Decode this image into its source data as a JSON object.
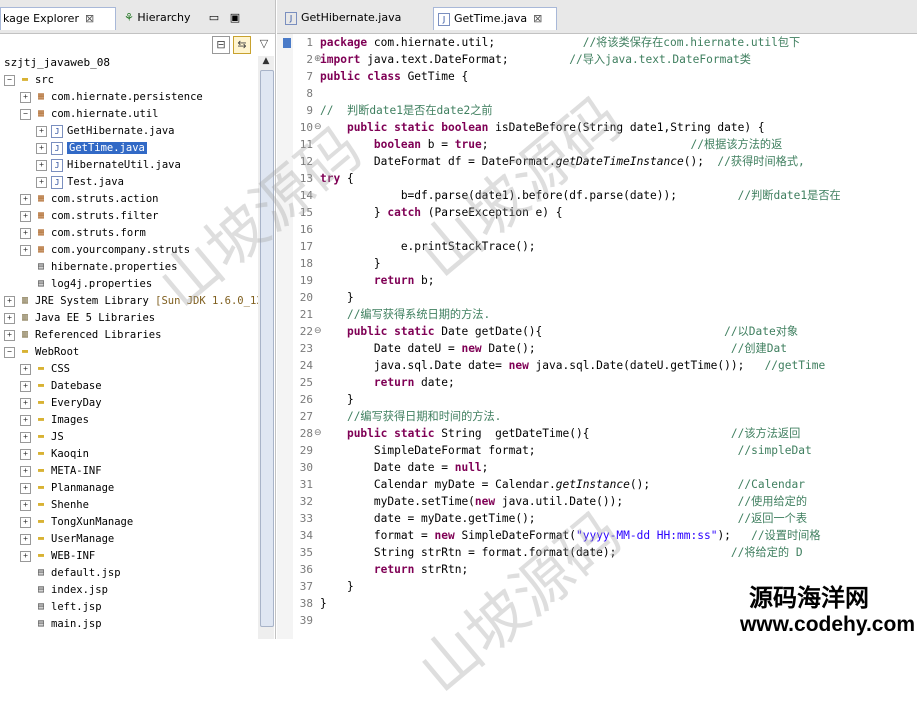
{
  "explorer": {
    "tab_label": "kage Explorer",
    "hierarchy_label": "Hierarchy",
    "project": "szjtj_javaweb_08",
    "tree": [
      {
        "depth": 0,
        "exp": "−",
        "icon": "folder",
        "label": "src"
      },
      {
        "depth": 1,
        "exp": "+",
        "icon": "pkg",
        "label": "com.hiernate.persistence"
      },
      {
        "depth": 1,
        "exp": "−",
        "icon": "pkg",
        "label": "com.hiernate.util"
      },
      {
        "depth": 2,
        "exp": "+",
        "icon": "java",
        "label": "GetHibernate.java"
      },
      {
        "depth": 2,
        "exp": "+",
        "icon": "java",
        "label": "GetTime.java",
        "selected": true
      },
      {
        "depth": 2,
        "exp": "+",
        "icon": "java",
        "label": "HibernateUtil.java"
      },
      {
        "depth": 2,
        "exp": "+",
        "icon": "java",
        "label": "Test.java"
      },
      {
        "depth": 1,
        "exp": "+",
        "icon": "pkg",
        "label": "com.struts.action"
      },
      {
        "depth": 1,
        "exp": "+",
        "icon": "pkg",
        "label": "com.struts.filter"
      },
      {
        "depth": 1,
        "exp": "+",
        "icon": "pkg",
        "label": "com.struts.form"
      },
      {
        "depth": 1,
        "exp": "+",
        "icon": "pkg",
        "label": "com.yourcompany.struts"
      },
      {
        "depth": 1,
        "exp": "",
        "icon": "file",
        "label": "hibernate.properties"
      },
      {
        "depth": 1,
        "exp": "",
        "icon": "file",
        "label": "log4j.properties"
      },
      {
        "depth": 0,
        "exp": "+",
        "icon": "lib",
        "label": "JRE System Library",
        "extra": "[Sun JDK 1.6.0_13]"
      },
      {
        "depth": 0,
        "exp": "+",
        "icon": "lib",
        "label": "Java EE 5 Libraries"
      },
      {
        "depth": 0,
        "exp": "+",
        "icon": "lib",
        "label": "Referenced Libraries"
      },
      {
        "depth": 0,
        "exp": "−",
        "icon": "folder",
        "label": "WebRoot"
      },
      {
        "depth": 1,
        "exp": "+",
        "icon": "folder",
        "label": "CSS"
      },
      {
        "depth": 1,
        "exp": "+",
        "icon": "folder",
        "label": "Datebase"
      },
      {
        "depth": 1,
        "exp": "+",
        "icon": "folder",
        "label": "EveryDay"
      },
      {
        "depth": 1,
        "exp": "+",
        "icon": "folder",
        "label": "Images"
      },
      {
        "depth": 1,
        "exp": "+",
        "icon": "folder",
        "label": "JS"
      },
      {
        "depth": 1,
        "exp": "+",
        "icon": "folder",
        "label": "Kaoqin"
      },
      {
        "depth": 1,
        "exp": "+",
        "icon": "folder",
        "label": "META-INF"
      },
      {
        "depth": 1,
        "exp": "+",
        "icon": "folder",
        "label": "Planmanage"
      },
      {
        "depth": 1,
        "exp": "+",
        "icon": "folder",
        "label": "Shenhe"
      },
      {
        "depth": 1,
        "exp": "+",
        "icon": "folder",
        "label": "TongXunManage"
      },
      {
        "depth": 1,
        "exp": "+",
        "icon": "folder",
        "label": "UserManage"
      },
      {
        "depth": 1,
        "exp": "+",
        "icon": "folder",
        "label": "WEB-INF"
      },
      {
        "depth": 1,
        "exp": "",
        "icon": "file",
        "label": "default.jsp"
      },
      {
        "depth": 1,
        "exp": "",
        "icon": "file",
        "label": "index.jsp"
      },
      {
        "depth": 1,
        "exp": "",
        "icon": "file",
        "label": "left.jsp"
      },
      {
        "depth": 1,
        "exp": "",
        "icon": "file",
        "label": "main.jsp"
      }
    ]
  },
  "editor": {
    "tabs": [
      {
        "label": "GetHibernate.java",
        "active": false
      },
      {
        "label": "GetTime.java",
        "active": true
      }
    ],
    "lines": [
      {
        "n": "1",
        "fold": "",
        "html": "<span class=\"kw\">package</span> com.hiernate.util;             <span class=\"cm\">//将该类保存在com.hiernate.util包下</span>"
      },
      {
        "n": "2",
        "fold": "+",
        "html": "<span class=\"kw\">import</span> java.text.DateFormat;         <span class=\"cm\">//导入java.text.DateFormat类</span>"
      },
      {
        "n": "7",
        "fold": "",
        "html": "<span class=\"kw\">public class</span> GetTime {"
      },
      {
        "n": "8",
        "fold": "",
        "html": ""
      },
      {
        "n": "9",
        "fold": "",
        "html": "<span class=\"cm\">//  判断date1是否在date2之前</span>"
      },
      {
        "n": "10",
        "fold": "−",
        "html": "    <span class=\"kw\">public static boolean</span> isDateBefore(String date1,String date) {"
      },
      {
        "n": "11",
        "fold": "",
        "html": "        <span class=\"kw\">boolean</span> b = <span class=\"kw\">true</span>;                              <span class=\"cm\">//根据该方法的返</span>"
      },
      {
        "n": "12",
        "fold": "",
        "html": "        DateFormat df = DateFormat.<span class=\"it\">getDateTimeInstance</span>();  <span class=\"cm\">//获得时间格式,</span>"
      },
      {
        "n": "13",
        "fold": "",
        "html": "<span class=\"kw\">try</span> {"
      },
      {
        "n": "14",
        "fold": "",
        "html": "            b=df.parse(date1).before(df.parse(date));         <span class=\"cm\">//判断date1是否在</span>"
      },
      {
        "n": "15",
        "fold": "",
        "html": "        } <span class=\"kw\">catch</span> (ParseException e) {"
      },
      {
        "n": "16",
        "fold": "",
        "html": ""
      },
      {
        "n": "17",
        "fold": "",
        "html": "            e.printStackTrace();"
      },
      {
        "n": "18",
        "fold": "",
        "html": "        }"
      },
      {
        "n": "19",
        "fold": "",
        "html": "        <span class=\"kw\">return</span> b;"
      },
      {
        "n": "20",
        "fold": "",
        "html": "    }"
      },
      {
        "n": "21",
        "fold": "",
        "html": "    <span class=\"cm\">//编写获得系统日期的方法.</span>"
      },
      {
        "n": "22",
        "fold": "−",
        "html": "    <span class=\"kw\">public static</span> Date getDate(){                           <span class=\"cm\">//以Date对象</span>"
      },
      {
        "n": "23",
        "fold": "",
        "html": "        Date dateU = <span class=\"kw\">new</span> Date();                             <span class=\"cm\">//创建Dat</span>"
      },
      {
        "n": "24",
        "fold": "",
        "html": "        java.sql.Date date= <span class=\"kw\">new</span> java.sql.Date(dateU.getTime());   <span class=\"cm\">//getTime</span>"
      },
      {
        "n": "25",
        "fold": "",
        "html": "        <span class=\"kw\">return</span> date;"
      },
      {
        "n": "26",
        "fold": "",
        "html": "    }"
      },
      {
        "n": "27",
        "fold": "",
        "html": "    <span class=\"cm\">//编写获得日期和时间的方法.</span>"
      },
      {
        "n": "28",
        "fold": "−",
        "html": "    <span class=\"kw\">public static</span> String  getDateTime(){                     <span class=\"cm\">//该方法返回</span>"
      },
      {
        "n": "29",
        "fold": "",
        "html": "        SimpleDateFormat format;                              <span class=\"cm\">//simpleDat</span>"
      },
      {
        "n": "30",
        "fold": "",
        "html": "        Date date = <span class=\"kw\">null</span>;"
      },
      {
        "n": "31",
        "fold": "",
        "html": "        Calendar myDate = Calendar.<span class=\"it\">getInstance</span>();             <span class=\"cm\">//Calendar </span>"
      },
      {
        "n": "32",
        "fold": "",
        "html": "        myDate.setTime(<span class=\"kw\">new</span> java.util.Date());                 <span class=\"cm\">//使用给定的</span>"
      },
      {
        "n": "33",
        "fold": "",
        "html": "        date = myDate.getTime();                              <span class=\"cm\">//返回一个表</span>"
      },
      {
        "n": "34",
        "fold": "",
        "html": "        format = <span class=\"kw\">new</span> SimpleDateFormat(<span class=\"st\">\"yyyy-MM-dd HH:mm:ss\"</span>);   <span class=\"cm\">//设置时间格</span>"
      },
      {
        "n": "35",
        "fold": "",
        "html": "        String strRtn = format.format(date);                 <span class=\"cm\">//将给定的 D</span>"
      },
      {
        "n": "36",
        "fold": "",
        "html": "        <span class=\"kw\">return</span> strRtn;"
      },
      {
        "n": "37",
        "fold": "",
        "html": "    }"
      },
      {
        "n": "38",
        "fold": "",
        "html": "}"
      },
      {
        "n": "39",
        "fold": "",
        "html": ""
      }
    ]
  },
  "watermarks": [
    "山坡源码",
    "山坡源码",
    "山坡源码"
  ],
  "brand": {
    "cn": "源码海洋网",
    "url": "www.codehy.com"
  }
}
